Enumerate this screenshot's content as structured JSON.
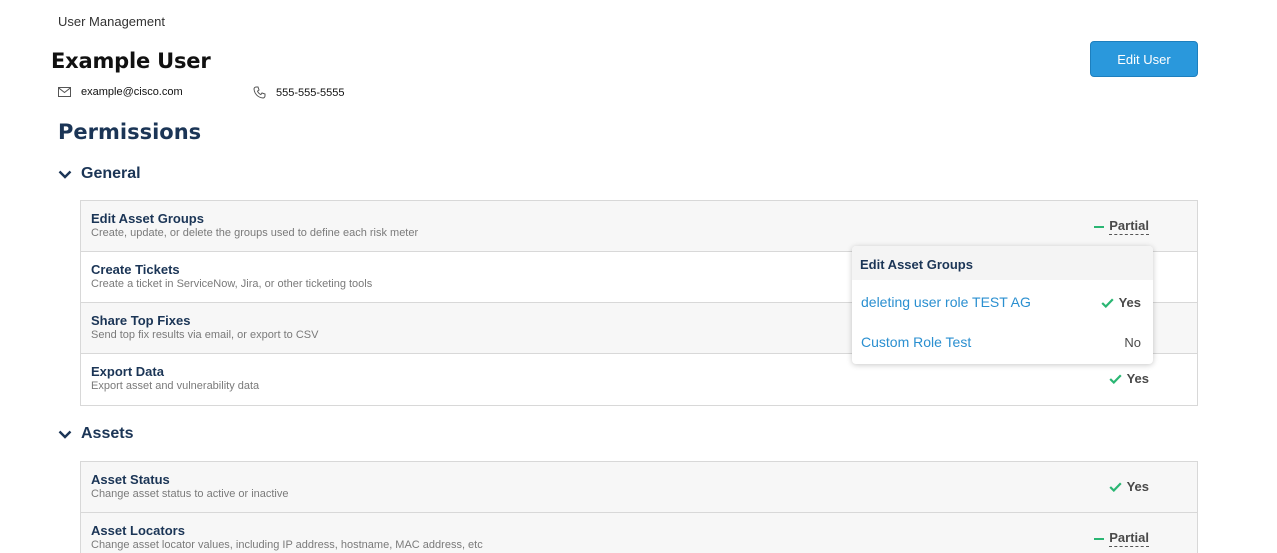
{
  "breadcrumb": "User Management",
  "user": {
    "name": "Example User",
    "email": "example@cisco.com",
    "phone": "555-555-5555",
    "edit_label": "Edit User"
  },
  "permissions_title": "Permissions",
  "groups": {
    "general": {
      "label": "General",
      "items": [
        {
          "name": "Edit Asset Groups",
          "desc": "Create, update, or delete the groups used to define each risk meter",
          "status": "Partial"
        },
        {
          "name": "Create Tickets",
          "desc": "Create a ticket in ServiceNow, Jira, or other ticketing tools",
          "status": ""
        },
        {
          "name": "Share Top Fixes",
          "desc": "Send top fix results via email, or export to CSV",
          "status": ""
        },
        {
          "name": "Export Data",
          "desc": "Export asset and vulnerability data",
          "status": "Yes"
        }
      ]
    },
    "assets": {
      "label": "Assets",
      "items": [
        {
          "name": "Asset Status",
          "desc": "Change asset status to active or inactive",
          "status": "Yes"
        },
        {
          "name": "Asset Locators",
          "desc": "Change asset locator values, including IP address, hostname, MAC address, etc",
          "status": "Partial"
        }
      ]
    }
  },
  "popover": {
    "title": "Edit Asset Groups",
    "rows": [
      {
        "label": "deleting user role TEST AG",
        "value": "Yes"
      },
      {
        "label": "Custom Role Test",
        "value": "No"
      }
    ]
  },
  "colors": {
    "accent": "#2a98dc",
    "heading": "#1b3556",
    "success": "#2ab673"
  }
}
